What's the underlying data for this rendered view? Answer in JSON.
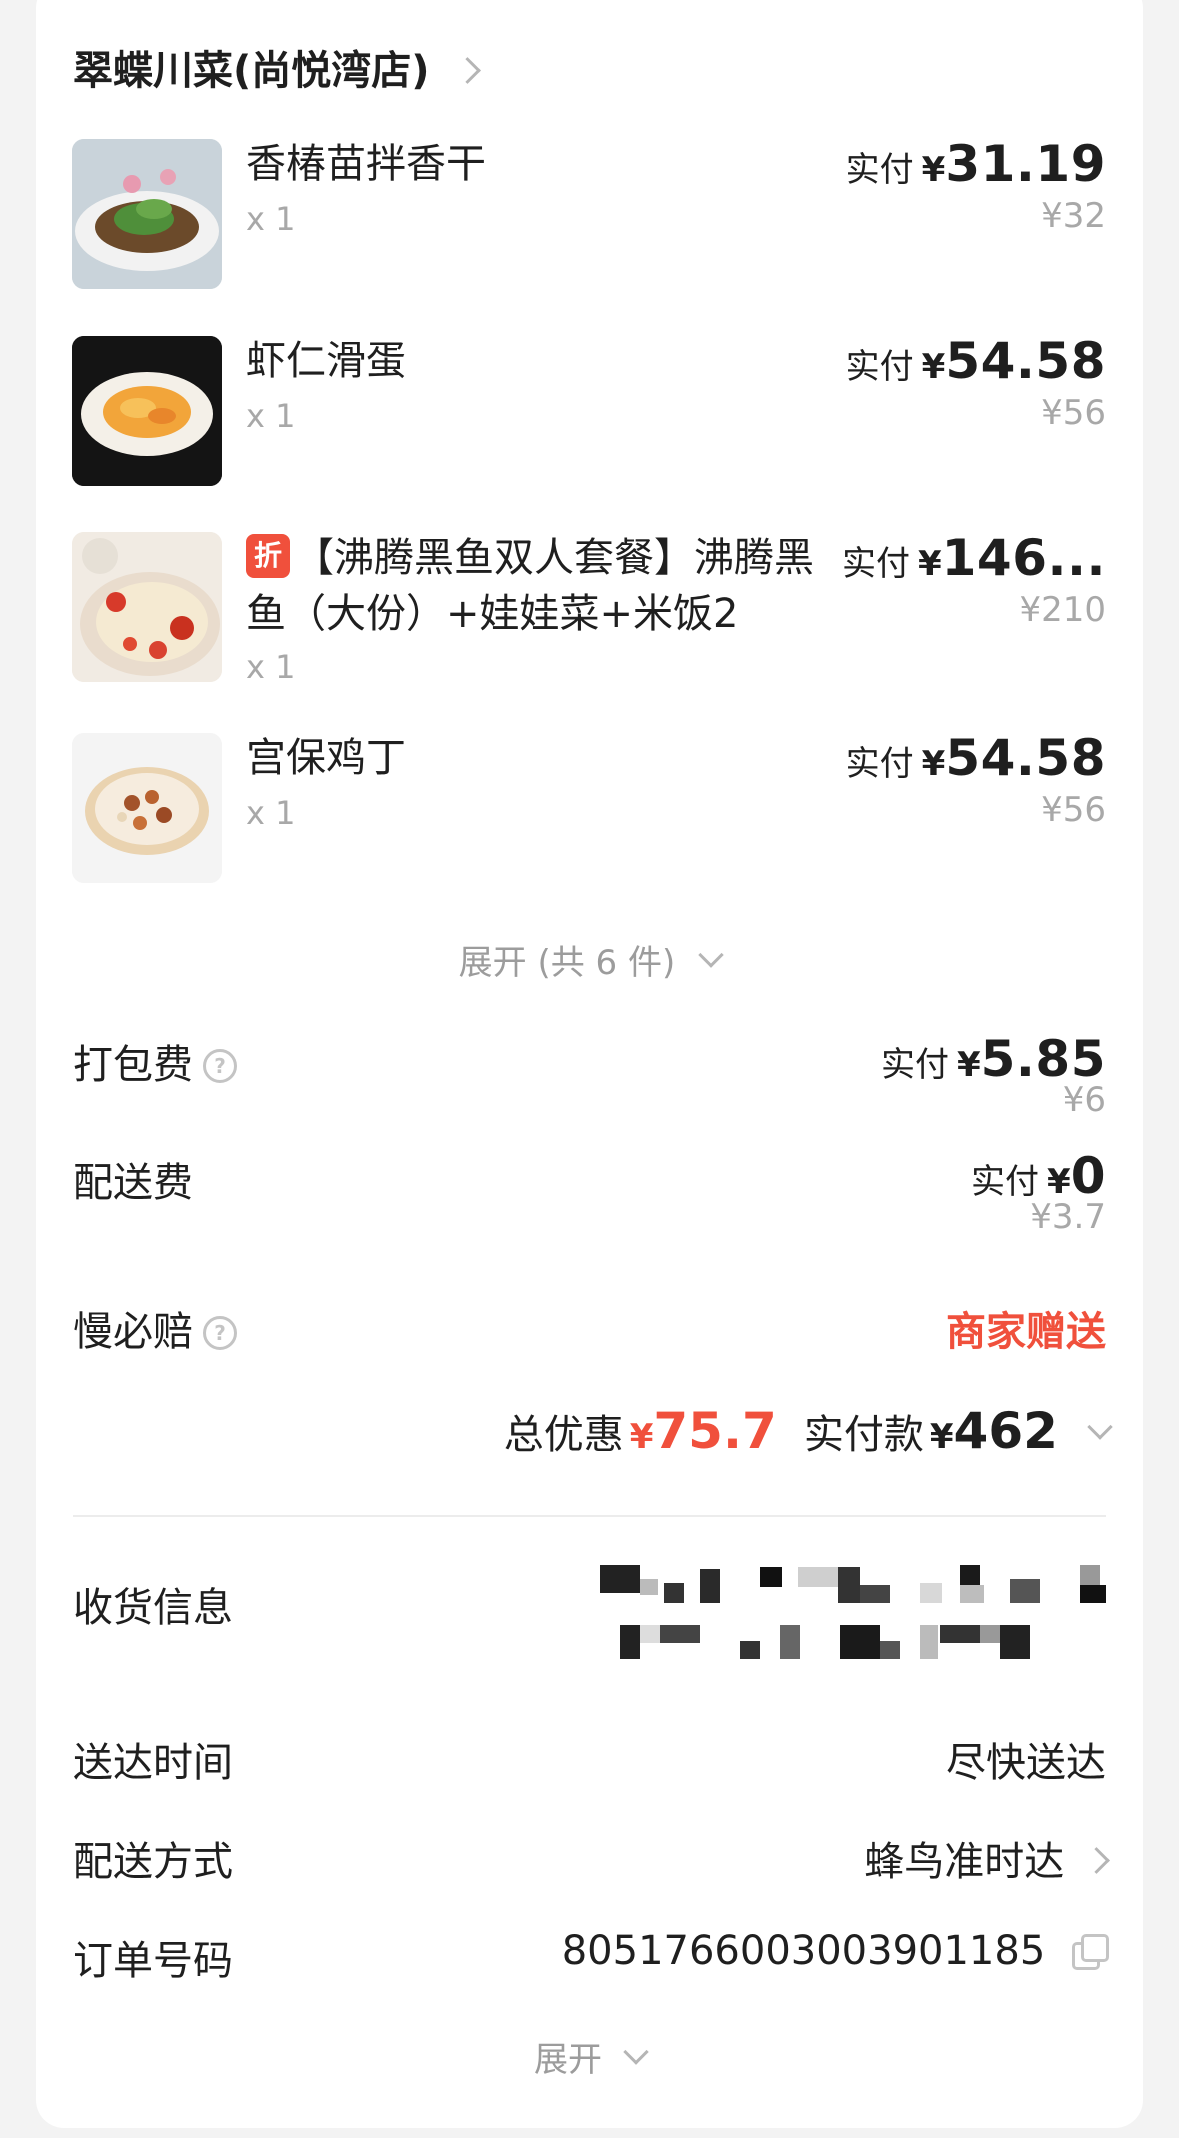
{
  "shop": {
    "name": "翠蝶川菜(尚悦湾店)"
  },
  "items": [
    {
      "name": "香椿苗拌香干",
      "qty": "x 1",
      "paid_label": "实付",
      "currency": "¥",
      "paid_amount": "31.19",
      "original_price": "¥32"
    },
    {
      "name": "虾仁滑蛋",
      "qty": "x 1",
      "paid_label": "实付",
      "currency": "¥",
      "paid_amount": "54.58",
      "original_price": "¥56"
    },
    {
      "tag": "折",
      "name": "【沸腾黑鱼双人套餐】沸腾黑鱼（大份）+娃娃菜+米饭2",
      "qty": "x 1",
      "paid_label": "实付",
      "currency": "¥",
      "paid_amount": "146...",
      "original_price": "¥210"
    },
    {
      "name": "宫保鸡丁",
      "qty": "x 1",
      "paid_label": "实付",
      "currency": "¥",
      "paid_amount": "54.58",
      "original_price": "¥56"
    }
  ],
  "expand_items_label": "展开 (共 6 件)",
  "fees": {
    "packaging": {
      "label": "打包费",
      "help": "?",
      "paid_label": "实付",
      "currency": "¥",
      "paid_amount": "5.85",
      "original_price": "¥6"
    },
    "delivery": {
      "label": "配送费",
      "paid_label": "实付",
      "currency": "¥",
      "paid_amount": "0",
      "original_price": "¥3.7"
    },
    "late_guarantee": {
      "label": "慢必赔",
      "help": "?",
      "value": "商家赠送"
    }
  },
  "summary": {
    "discount_label": "总优惠",
    "discount_currency": "¥",
    "discount_amount": "75.7",
    "paid_label": "实付款",
    "paid_currency": "¥",
    "paid_amount": "462"
  },
  "info": {
    "address_label": "收货信息",
    "delivery_time_label": "送达时间",
    "delivery_time_value": "尽快送达",
    "delivery_method_label": "配送方式",
    "delivery_method_value": "蜂鸟准时达",
    "order_no_label": "订单号码",
    "order_no_value": "8051766003003901185"
  },
  "expand_more_label": "展开",
  "colors": {
    "accent_red": "#f0503c",
    "muted_text": "#a8a8a8",
    "background": "#f3f3f3",
    "card": "#ffffff"
  }
}
